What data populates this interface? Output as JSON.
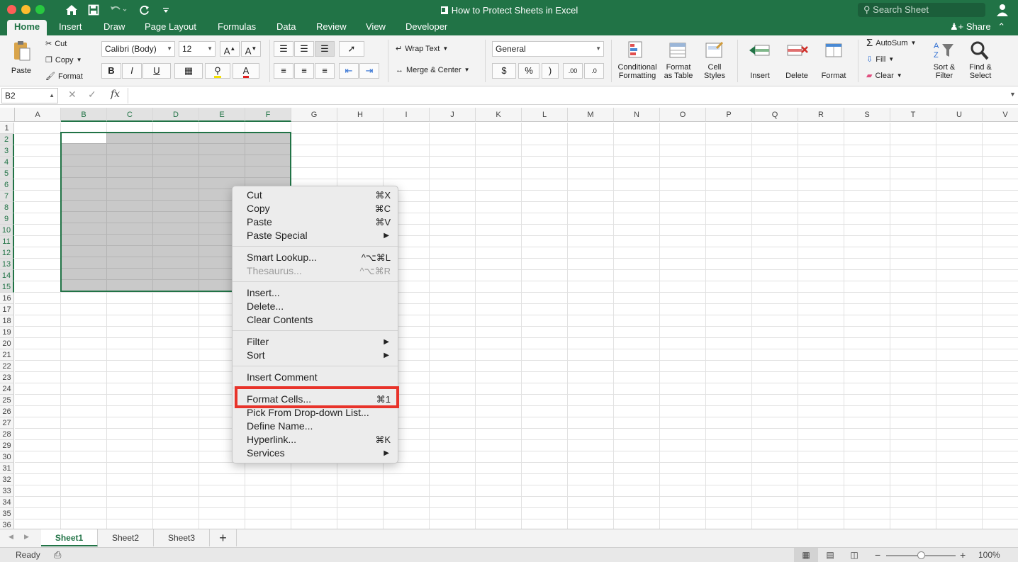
{
  "window": {
    "title": "How to Protect Sheets in Excel",
    "search_placeholder": "Search Sheet"
  },
  "tabs": [
    "Home",
    "Insert",
    "Draw",
    "Page Layout",
    "Formulas",
    "Data",
    "Review",
    "View",
    "Developer"
  ],
  "share_label": "Share",
  "ribbon": {
    "paste": "Paste",
    "cut": "Cut",
    "copy": "Copy",
    "format": "Format",
    "font_name": "Calibri (Body)",
    "font_size": "12",
    "bold": "B",
    "italic": "I",
    "underline": "U",
    "wrap_text": "Wrap Text",
    "merge_center": "Merge & Center",
    "number_format": "General",
    "currency": "$",
    "percent": "%",
    "comma": ")",
    "inc_decimal": ".00",
    "dec_decimal": ".0",
    "conditional_1": "Conditional",
    "conditional_2": "Formatting",
    "format_table_1": "Format",
    "format_table_2": "as Table",
    "cell_styles_1": "Cell",
    "cell_styles_2": "Styles",
    "insert": "Insert",
    "delete": "Delete",
    "format_cells": "Format",
    "autosum": "AutoSum",
    "fill": "Fill",
    "clear": "Clear",
    "sort_1": "Sort &",
    "sort_2": "Filter",
    "find_1": "Find &",
    "find_2": "Select"
  },
  "formula_bar": {
    "name_box": "B2",
    "fx": "fx"
  },
  "columns": [
    "A",
    "B",
    "C",
    "D",
    "E",
    "F",
    "G",
    "H",
    "I",
    "J",
    "K",
    "L",
    "M",
    "N",
    "O",
    "P",
    "Q",
    "R",
    "S",
    "T",
    "U",
    "V"
  ],
  "rows": [
    "1",
    "2",
    "3",
    "4",
    "5",
    "6",
    "7",
    "8",
    "9",
    "10",
    "11",
    "12",
    "13",
    "14",
    "15",
    "16",
    "17",
    "18",
    "19",
    "20",
    "21",
    "22",
    "23",
    "24",
    "25",
    "26",
    "27",
    "28",
    "29",
    "30",
    "31",
    "32",
    "33",
    "34",
    "35",
    "36"
  ],
  "context_menu": [
    {
      "label": "Cut",
      "shortcut": "⌘X"
    },
    {
      "label": "Copy",
      "shortcut": "⌘C"
    },
    {
      "label": "Paste",
      "shortcut": "⌘V"
    },
    {
      "label": "Paste Special",
      "submenu": "▶"
    },
    {
      "label": "Smart Lookup...",
      "shortcut": "^⌥⌘L"
    },
    {
      "label": "Thesaurus...",
      "shortcut": "^⌥⌘R",
      "disabled": true
    },
    {
      "label": "Insert..."
    },
    {
      "label": "Delete..."
    },
    {
      "label": "Clear Contents"
    },
    {
      "label": "Filter",
      "submenu": "▶"
    },
    {
      "label": "Sort",
      "submenu": "▶"
    },
    {
      "label": "Insert Comment"
    },
    {
      "label": "Format Cells...",
      "shortcut": "⌘1"
    },
    {
      "label": "Pick From Drop-down List..."
    },
    {
      "label": "Define Name..."
    },
    {
      "label": "Hyperlink...",
      "shortcut": "⌘K"
    },
    {
      "label": "Services",
      "submenu": "▶"
    }
  ],
  "sheets": [
    "Sheet1",
    "Sheet2",
    "Sheet3"
  ],
  "add_sheet": "+",
  "status": {
    "ready": "Ready",
    "zoom": "100%",
    "zoom_minus": "−",
    "zoom_plus": "+"
  },
  "colors": {
    "accent": "#217346",
    "highlight": "#e8332a"
  }
}
